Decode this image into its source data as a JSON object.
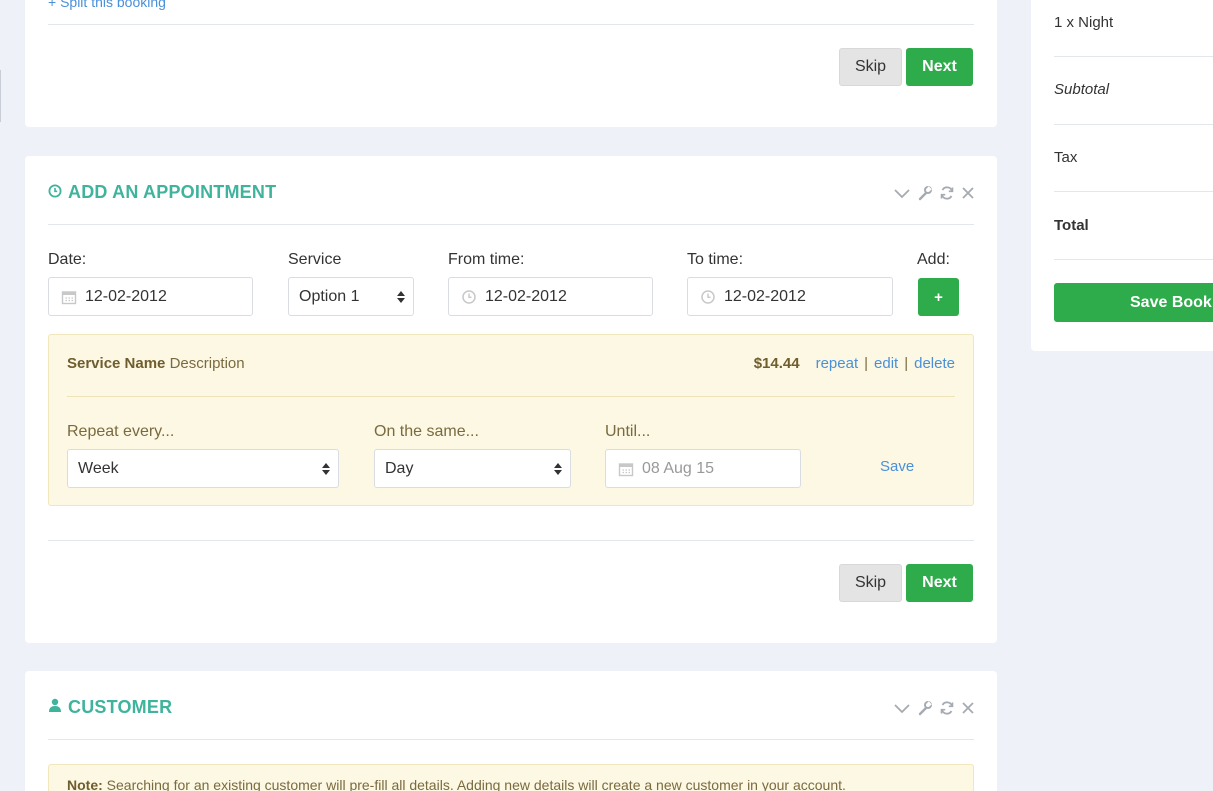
{
  "top_panel": {
    "split_link": "+ Split this booking",
    "skip_label": "Skip",
    "next_label": "Next"
  },
  "appointment": {
    "title": "ADD AN APPOINTMENT",
    "date_label": "Date:",
    "date_value": "12-02-2012",
    "service_label": "Service",
    "service_value": "Option 1",
    "from_label": "From time:",
    "from_value": "12-02-2012",
    "to_label": "To time:",
    "to_value": "12-02-2012",
    "add_label": "Add:",
    "add_button": "+",
    "service_item": {
      "name": "Service Name",
      "description": "Description",
      "price": "$14.44",
      "repeat_link": "repeat",
      "edit_link": "edit",
      "delete_link": "delete",
      "sep": "|",
      "repeat_every_label": "Repeat every...",
      "repeat_every_value": "Week",
      "on_same_label": "On the same...",
      "on_same_value": "Day",
      "until_label": "Until...",
      "until_placeholder": "08 Aug 15",
      "save_link": "Save"
    },
    "skip_label": "Skip",
    "next_label": "Next"
  },
  "customer": {
    "title": "CUSTOMER",
    "note_label": "Note:",
    "note_text": " Searching for an existing customer will pre-fill all details. Adding new details will create a new customer in your account."
  },
  "summary": {
    "night": "1 x Night",
    "subtotal": "Subtotal",
    "tax": "Tax",
    "total": "Total",
    "save_button": "Save Booking"
  },
  "colors": {
    "accent_teal": "#3fb39c",
    "button_green": "#2eab4a",
    "link_blue": "#4a90d9",
    "warning_bg": "#fcf8e3"
  }
}
